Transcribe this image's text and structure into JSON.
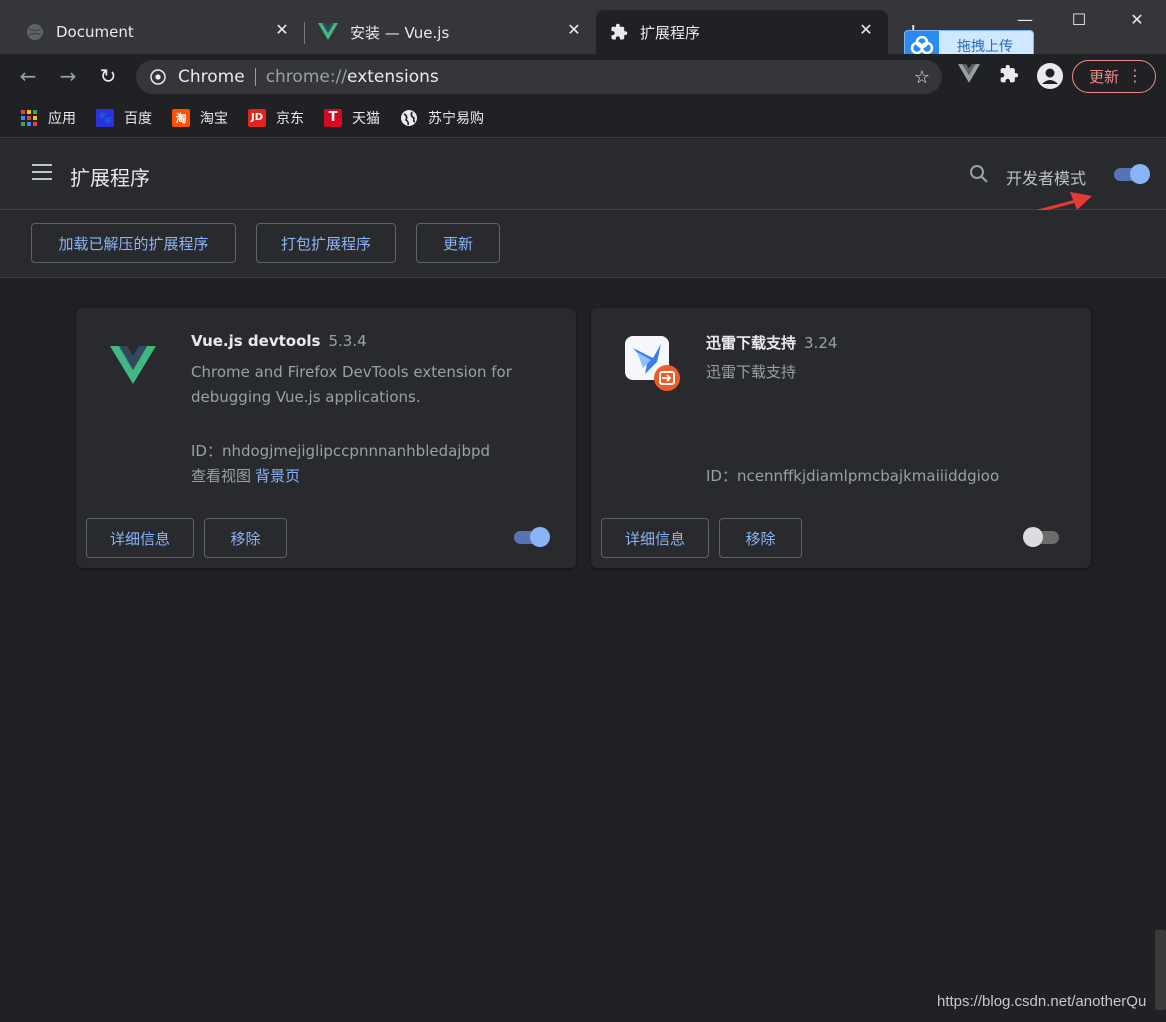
{
  "tabs": [
    {
      "title": "Document",
      "icon": "globe-icon"
    },
    {
      "title": "安装 — Vue.js",
      "icon": "vue-icon"
    },
    {
      "title": "扩展程序",
      "icon": "puzzle-icon"
    }
  ],
  "upload_overlay": {
    "label": "拖拽上传"
  },
  "omnibox": {
    "origin": "Chrome",
    "scheme": "chrome://",
    "path": "extensions"
  },
  "update_button": {
    "label": "更新"
  },
  "bookmarks": [
    {
      "label": "应用",
      "icon": "apps-grid-icon",
      "color": "#e94235"
    },
    {
      "label": "百度",
      "icon": "baidu-paw-icon",
      "color": "#2932e1"
    },
    {
      "label": "淘宝",
      "icon": "taobao-icon",
      "color": "#ff5000"
    },
    {
      "label": "京东",
      "icon": "jd-icon",
      "color": "#e1251b"
    },
    {
      "label": "天猫",
      "icon": "tmall-icon",
      "color": "#d50b1f"
    },
    {
      "label": "苏宁易购",
      "icon": "globe-icon",
      "color": "#e8eaed"
    }
  ],
  "header": {
    "title": "扩展程序",
    "dev_mode_label": "开发者模式",
    "dev_mode_on": true
  },
  "actions": {
    "load_unpacked": "加载已解压的扩展程序",
    "pack": "打包扩展程序",
    "update": "更新"
  },
  "extensions": [
    {
      "name": "Vue.js devtools",
      "version": "5.3.4",
      "description": "Chrome and Firefox DevTools extension for debugging Vue.js applications.",
      "id_label": "ID：nhdogjmejiglipccpnnnanhbledajbpd",
      "views_label": "查看视图",
      "views_link": "背景页",
      "details_label": "详细信息",
      "remove_label": "移除",
      "enabled": true
    },
    {
      "name": "迅雷下载支持",
      "version": "3.24",
      "description": "迅雷下载支持",
      "id_label": "ID：ncennffkjdiamlpmcbajkmaiiiddgioo",
      "details_label": "详细信息",
      "remove_label": "移除",
      "enabled": false
    }
  ],
  "watermark": "https://blog.csdn.net/anotherQu",
  "colors": {
    "accent": "#8ab4f8",
    "background": "#202124",
    "card": "#292a2d",
    "annotation_arrow": "#e53935"
  }
}
